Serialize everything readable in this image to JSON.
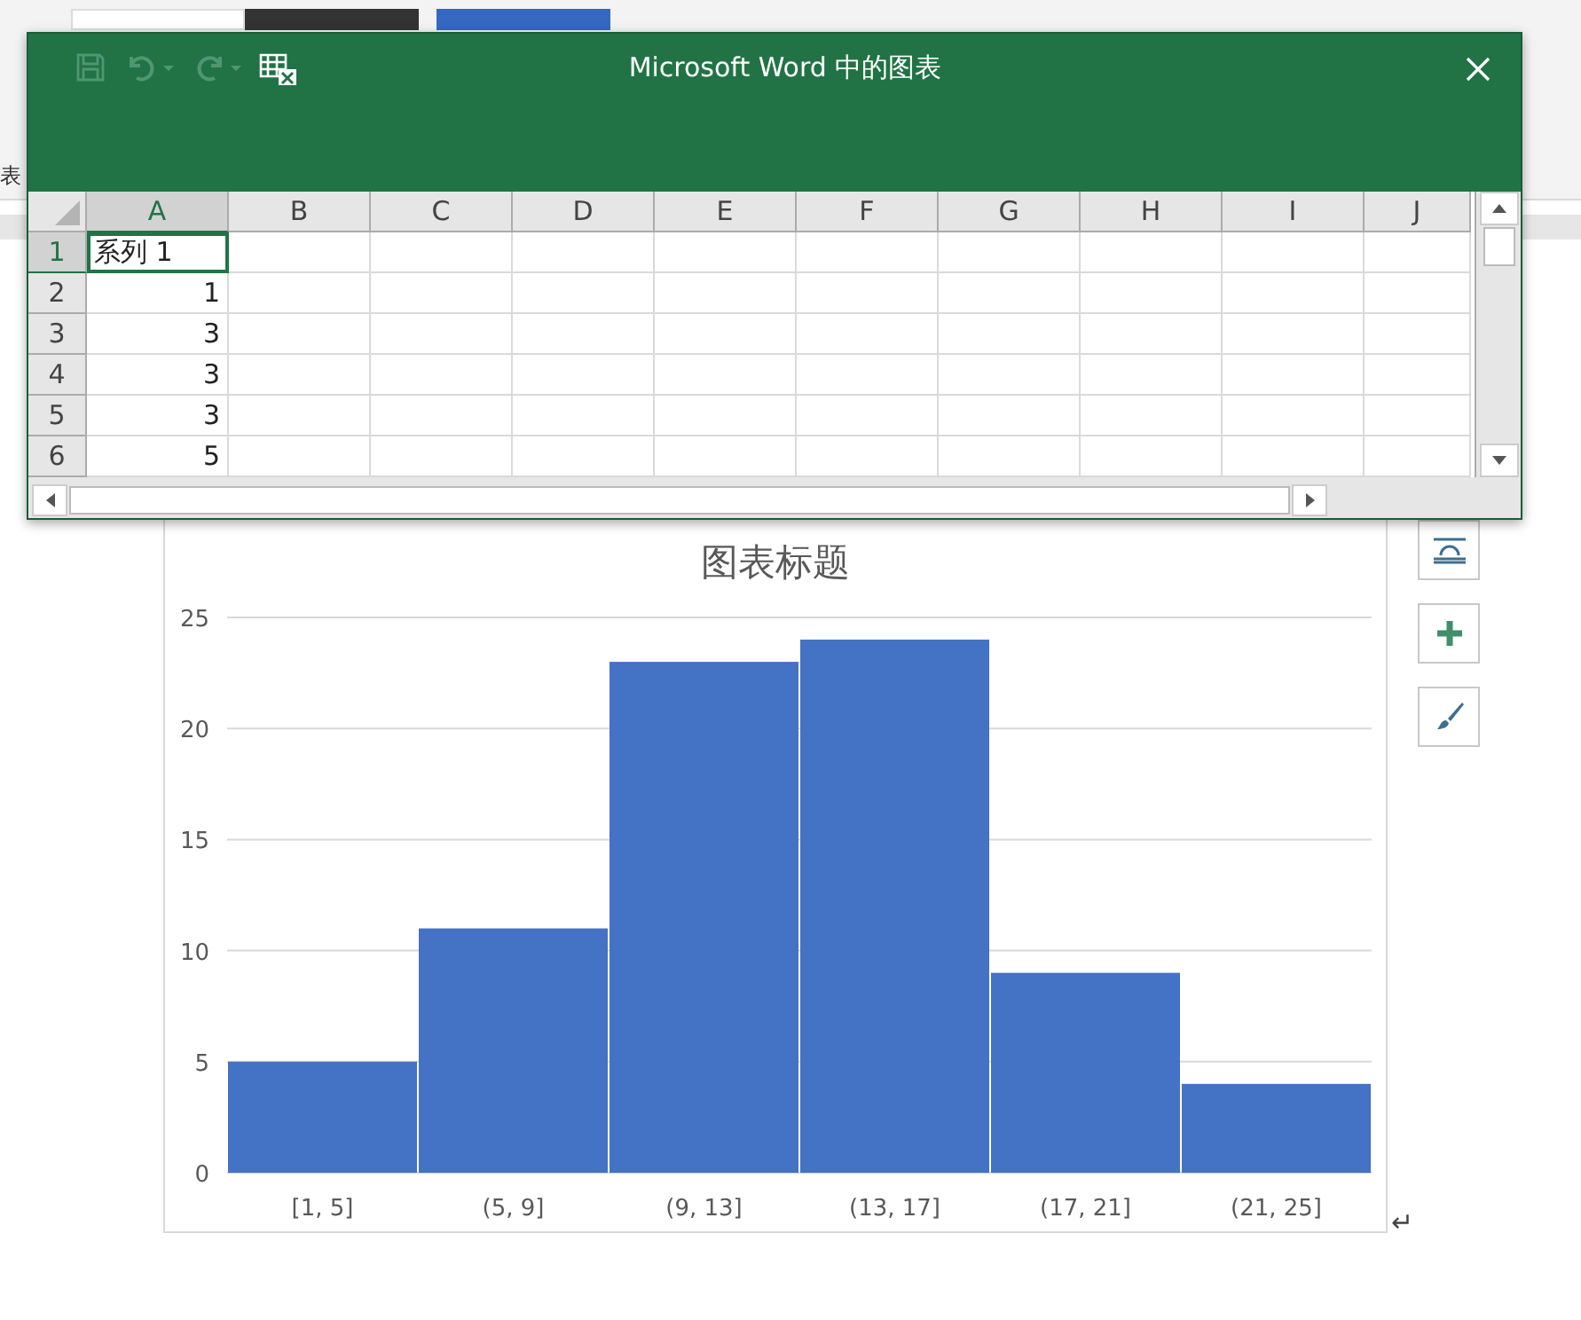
{
  "background": {
    "ribbon_fragment": "表"
  },
  "dialog": {
    "title": "Microsoft Word 中的图表",
    "toolbar": [
      {
        "kind": "save",
        "disabled": true
      },
      {
        "kind": "undo",
        "disabled": true
      },
      {
        "kind": "redo",
        "disabled": true
      },
      {
        "kind": "edit-in-excel",
        "disabled": false
      }
    ],
    "columns": [
      {
        "label": "A",
        "selected": true
      },
      {
        "label": "B",
        "selected": false
      },
      {
        "label": "C",
        "selected": false
      },
      {
        "label": "D",
        "selected": false
      },
      {
        "label": "E",
        "selected": false
      },
      {
        "label": "F",
        "selected": false
      },
      {
        "label": "G",
        "selected": false
      },
      {
        "label": "H",
        "selected": false
      },
      {
        "label": "I",
        "selected": false
      },
      {
        "label": "J",
        "selected": false
      }
    ],
    "rows": [
      {
        "number": "1",
        "selected": true,
        "a": "系列 1",
        "kind": "text"
      },
      {
        "number": "2",
        "selected": false,
        "a": "1",
        "kind": "number"
      },
      {
        "number": "3",
        "selected": false,
        "a": "3",
        "kind": "number"
      },
      {
        "number": "4",
        "selected": false,
        "a": "3",
        "kind": "number"
      },
      {
        "number": "5",
        "selected": false,
        "a": "3",
        "kind": "number"
      },
      {
        "number": "6",
        "selected": false,
        "a": "5",
        "kind": "number"
      }
    ]
  },
  "chart": {
    "chart_data": {
      "type": "bar",
      "title": "图表标题",
      "categories": [
        "[1, 5]",
        "(5, 9]",
        "(9, 13]",
        "(13, 17]",
        "(17, 21]",
        "(21, 25]"
      ],
      "series": [
        {
          "color": "#4472c4",
          "values": [
            5,
            11,
            23,
            24,
            9,
            4
          ]
        }
      ],
      "ylim": [
        0,
        25
      ],
      "yticks": [
        0,
        5,
        10,
        15,
        20,
        25
      ],
      "grid": true
    }
  },
  "paragraph_mark": "↵"
}
